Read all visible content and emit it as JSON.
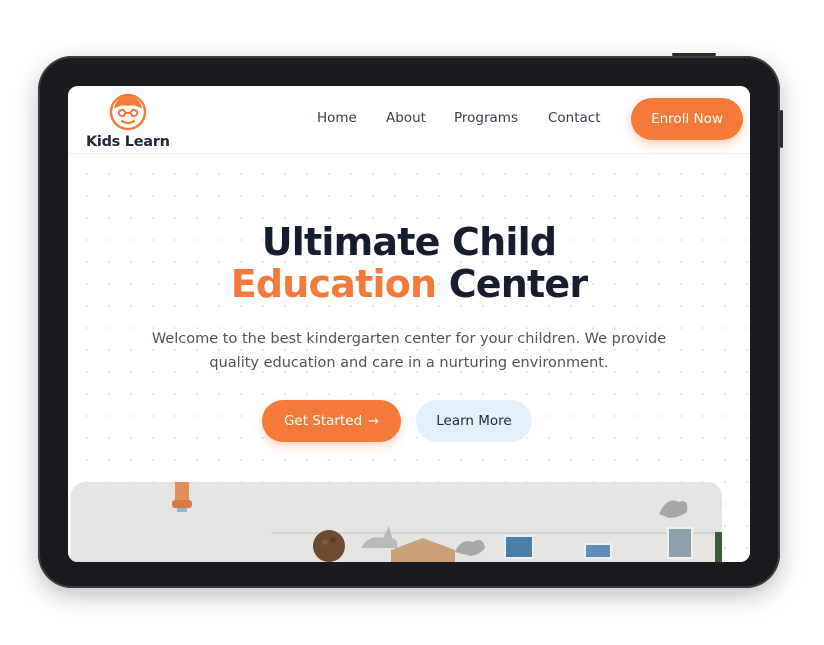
{
  "device": {
    "type": "tablet",
    "frame_color": "#1b1b1f"
  },
  "header": {
    "logo_text": "Kids Learn",
    "logo_icon": "child-face-icon",
    "nav": [
      {
        "label": "Home"
      },
      {
        "label": "About"
      },
      {
        "label": "Programs"
      },
      {
        "label": "Contact"
      }
    ],
    "cta_label": "Enroll Now"
  },
  "hero": {
    "title_line1": "Ultimate Child",
    "title_accent": "Education",
    "title_rest": "Center",
    "subtitle": "Welcome to the best kindergarten center for your children. We provide quality education and care in a nurturing environment.",
    "primary_label": "Get Started",
    "primary_icon": "arrow-right-icon",
    "secondary_label": "Learn More",
    "image": "classroom-photo"
  },
  "colors": {
    "accent": "#f47a3a",
    "heading": "#161d2e",
    "body_text": "#4b5563",
    "secondary_button_bg": "#e3f0fb"
  }
}
